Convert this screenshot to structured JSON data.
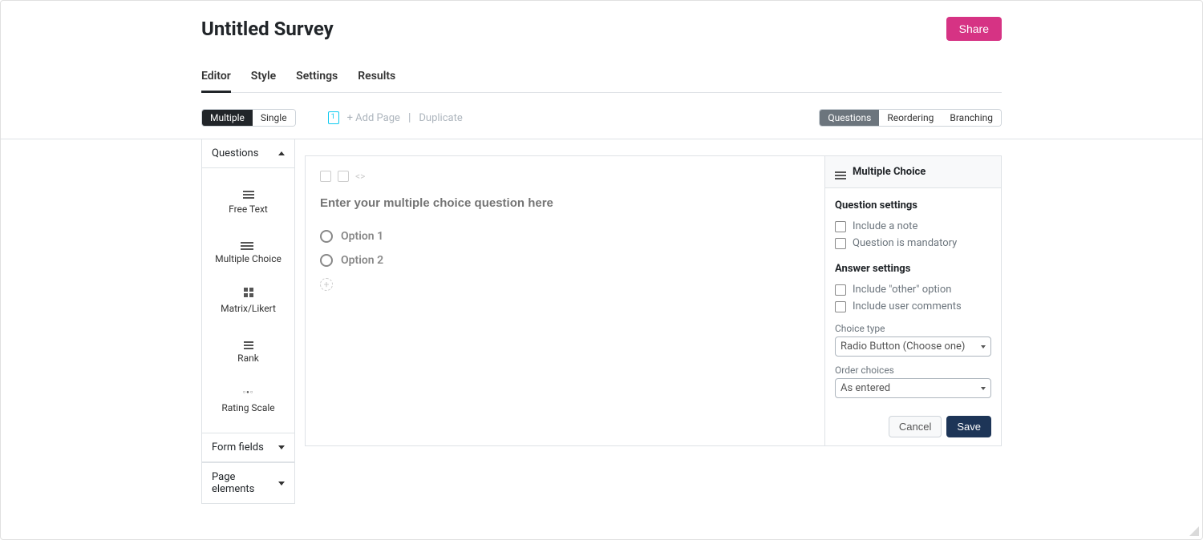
{
  "header": {
    "title": "Untitled Survey",
    "share_label": "Share"
  },
  "tabs": {
    "editor": "Editor",
    "style": "Style",
    "settings": "Settings",
    "results": "Results"
  },
  "toolbar": {
    "page_toggle": {
      "multiple": "Multiple",
      "single": "Single"
    },
    "add_page": "+ Add Page",
    "duplicate": "Duplicate",
    "view_toggle": {
      "questions": "Questions",
      "reordering": "Reordering",
      "branching": "Branching"
    }
  },
  "sidebar": {
    "sections": {
      "questions": "Questions",
      "form_fields": "Form fields",
      "page_elements": "Page elements"
    },
    "palette": {
      "free_text": "Free Text",
      "multiple_choice": "Multiple Choice",
      "matrix_likert": "Matrix/Likert",
      "rank": "Rank",
      "rating_scale": "Rating Scale"
    }
  },
  "question": {
    "placeholder": "Enter your multiple choice question here",
    "options": [
      "Option 1",
      "Option 2"
    ]
  },
  "settings_panel": {
    "title": "Multiple Choice",
    "question_settings_header": "Question settings",
    "include_note": "Include a note",
    "mandatory": "Question is mandatory",
    "answer_settings_header": "Answer settings",
    "include_other": "Include \"other\" option",
    "include_comments": "Include user comments",
    "choice_type_label": "Choice type",
    "choice_type_value": "Radio Button (Choose one)",
    "order_label": "Order choices",
    "order_value": "As entered",
    "cancel": "Cancel",
    "save": "Save"
  }
}
